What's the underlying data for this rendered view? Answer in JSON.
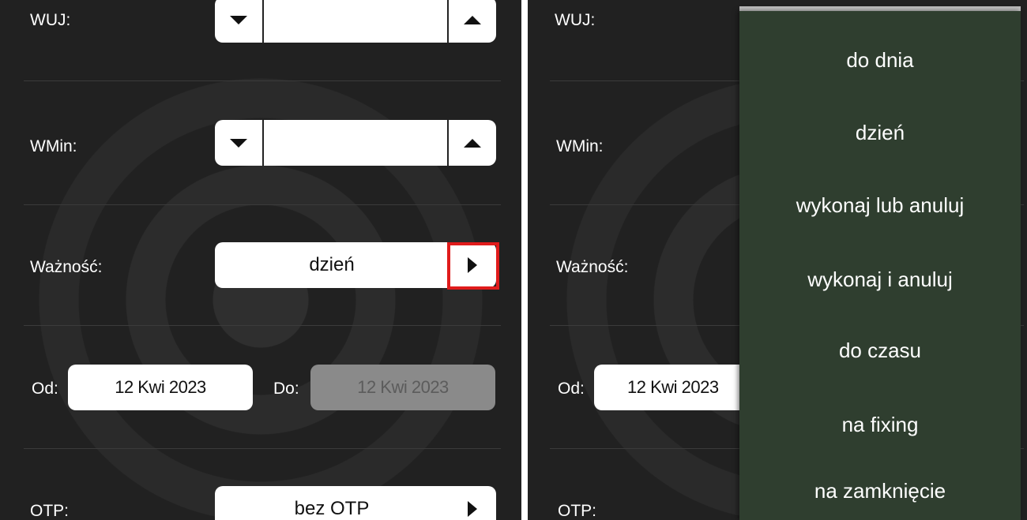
{
  "left": {
    "wuj_label": "WUJ:",
    "wmin_label": "WMin:",
    "waznosc_label": "Ważność:",
    "waznosc_value": "dzień",
    "od_label": "Od:",
    "od_value": "12 Kwi 2023",
    "do_label": "Do:",
    "do_value": "12 Kwi 2023",
    "otp_label": "OTP:",
    "otp_value": "bez OTP"
  },
  "right": {
    "wuj_label": "WUJ:",
    "wmin_label": "WMin:",
    "waznosc_label": "Ważność:",
    "od_label": "Od:",
    "od_value": "12 Kwi 2023",
    "otp_label": "OTP:"
  },
  "dropdown": {
    "items": [
      "do dnia",
      "dzień",
      "wykonaj lub anuluj",
      "wykonaj i anuluj",
      "do czasu",
      "na fixing",
      "na zamknięcie"
    ]
  },
  "colors": {
    "highlight": "#e01b1b",
    "dropdown_bg": "#2f3e2f",
    "panel_bg": "#212121"
  },
  "icons": {
    "stepper_decrement": "triangle-down-icon",
    "stepper_increment": "triangle-up-icon",
    "select_arrow": "triangle-right-icon"
  }
}
